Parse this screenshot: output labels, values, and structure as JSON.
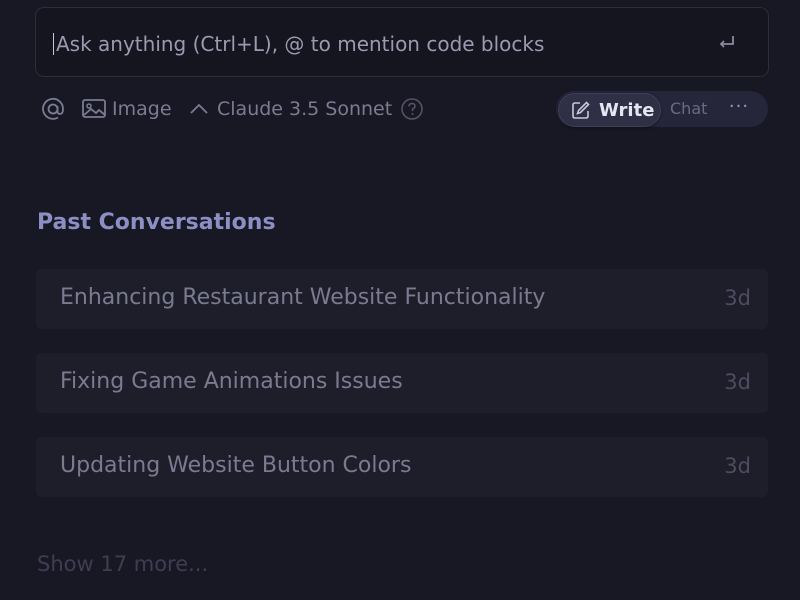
{
  "prompt": {
    "placeholder": "Ask anything (Ctrl+L), @ to mention code blocks",
    "value": "",
    "submit_icon": "enter-return-icon"
  },
  "toolbar": {
    "mention_icon": "at-sign-icon",
    "image_label": "Image",
    "image_icon": "image-icon",
    "model_label": "Claude 3.5 Sonnet",
    "model_icon": "chevron-up-icon",
    "help_icon": "question-circle-icon"
  },
  "mode": {
    "write_label": "Write",
    "write_icon": "pencil-icon",
    "chat_label": "Chat",
    "more_label": "···",
    "selected": "Write"
  },
  "past": {
    "title": "Past Conversations",
    "items": [
      {
        "title": "Enhancing Restaurant Website Functionality",
        "age": "3d"
      },
      {
        "title": "Fixing Game Animations Issues",
        "age": "3d"
      },
      {
        "title": "Updating Website Button Colors",
        "age": "3d"
      }
    ],
    "show_more": "Show 17 more..."
  },
  "colors": {
    "background": "#181824",
    "accent": "#8c8fc4"
  }
}
